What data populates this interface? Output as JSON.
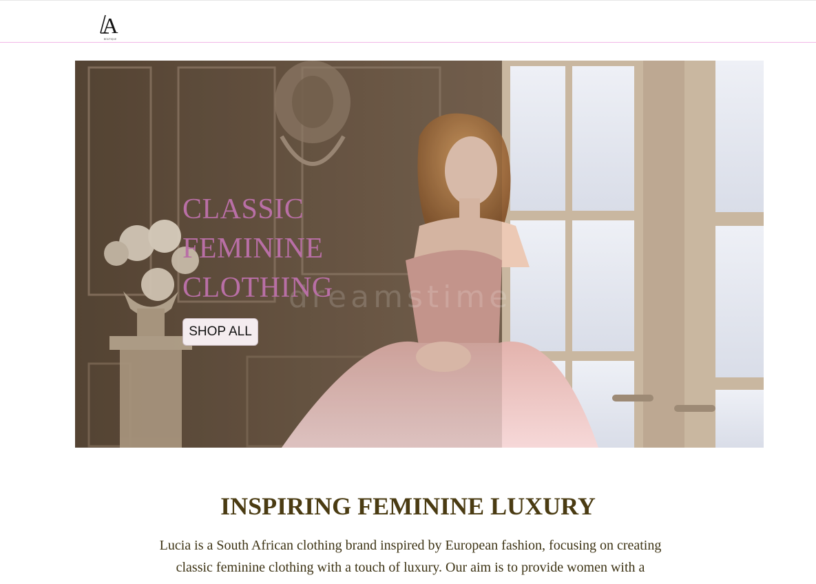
{
  "header": {
    "logo_alt": "LA",
    "logo_tagline": "BOUTIQUE"
  },
  "hero": {
    "title_lines": [
      "CLASSIC",
      "FEMININE",
      "CLOTHING"
    ],
    "cta_label": "SHOP ALL",
    "watermark": "dreamstime",
    "title_color": "#b96fa6"
  },
  "about": {
    "heading": "INSPIRING FEMININE LUXURY",
    "body": "Lucia is a South African clothing brand inspired by European fashion, focusing on creating classic feminine clothing with a touch of luxury. Our aim is to provide women with a",
    "heading_color": "#4a3b12"
  },
  "colors": {
    "header_border": "#f2b6e6",
    "button_bg": "#f4ecef"
  }
}
